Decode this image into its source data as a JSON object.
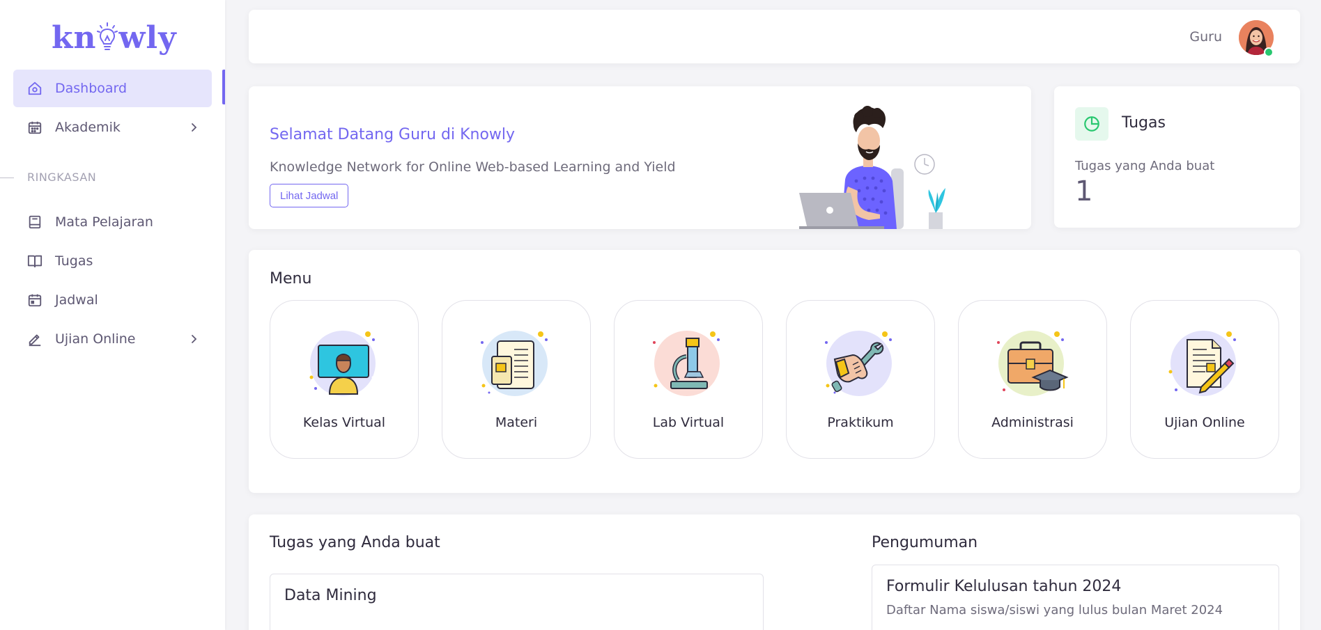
{
  "brand": {
    "logo_text_left": "kn",
    "logo_text_right": "wly",
    "accent": "#7367f0"
  },
  "sidebar": {
    "items": [
      {
        "label": "Dashboard",
        "icon": "home-icon",
        "active": true
      },
      {
        "label": "Akademik",
        "icon": "calendar-icon",
        "has_submenu": true
      },
      {
        "label": "Mata Pelajaran",
        "icon": "book-icon"
      },
      {
        "label": "Tugas",
        "icon": "open-book-icon"
      },
      {
        "label": "Jadwal",
        "icon": "calendar-filled-icon"
      },
      {
        "label": "Ujian Online",
        "icon": "pencil-icon",
        "has_submenu": true
      }
    ],
    "section_label": "RINGKASAN"
  },
  "topbar": {
    "user_name": "Guru",
    "status": "online",
    "status_color": "#28c76f"
  },
  "welcome": {
    "title": "Selamat Datang Guru di Knowly",
    "subtitle": "Knowledge Network for Online Web-based Learning and Yield",
    "button_label": "Lihat Jadwal"
  },
  "tugas_card": {
    "title": "Tugas",
    "subtitle": "Tugas yang Anda buat",
    "count": "1",
    "icon": "pie-chart-icon"
  },
  "menu": {
    "title": "Menu",
    "tiles": [
      {
        "label": "Kelas Virtual",
        "icon": "virtual-class-icon",
        "bg": "#e3e2fb"
      },
      {
        "label": "Materi",
        "icon": "document-scroll-icon",
        "bg": "#d8e8f8"
      },
      {
        "label": "Lab Virtual",
        "icon": "microscope-icon",
        "bg": "#fbdcd6"
      },
      {
        "label": "Praktikum",
        "icon": "wrench-hand-icon",
        "bg": "#e3e2fb"
      },
      {
        "label": "Administrasi",
        "icon": "briefcase-graduation-icon",
        "bg": "#e8f0c8"
      },
      {
        "label": "Ujian Online",
        "icon": "exam-paper-icon",
        "bg": "#e3e2fb"
      }
    ]
  },
  "tasks": {
    "title": "Tugas yang Anda buat",
    "items": [
      {
        "title": "Data Mining"
      }
    ]
  },
  "announcements": {
    "title": "Pengumuman",
    "items": [
      {
        "title": "Formulir Kelulusan tahun 2024",
        "subtitle": "Daftar Nama siswa/siswi yang lulus bulan Maret 2024"
      }
    ]
  }
}
